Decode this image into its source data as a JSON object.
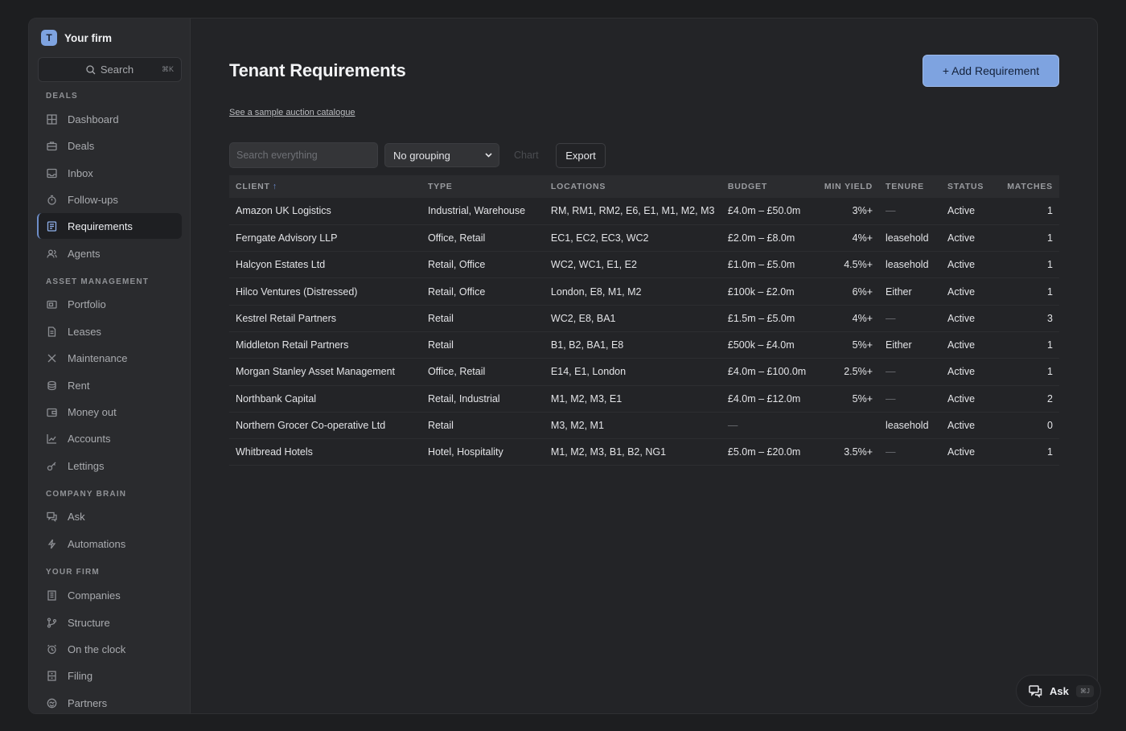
{
  "brand": {
    "logo_letter": "T",
    "name": "Your firm"
  },
  "sidebar": {
    "search_label": "Search",
    "search_shortcut": "⌘K",
    "sections": [
      {
        "label": "DEALS"
      },
      {
        "label": "ASSET MANAGEMENT"
      },
      {
        "label": "COMPANY BRAIN"
      },
      {
        "label": "YOUR FIRM"
      }
    ],
    "items": [
      {
        "label": "Dashboard",
        "icon": "grid-icon"
      },
      {
        "label": "Deals",
        "icon": "briefcase-icon"
      },
      {
        "label": "Inbox",
        "icon": "inbox-icon"
      },
      {
        "label": "Follow-ups",
        "icon": "timer-icon"
      },
      {
        "label": "Requirements",
        "icon": "clipboard-icon",
        "active": true
      },
      {
        "label": "Agents",
        "icon": "users-icon"
      },
      {
        "label": "Portfolio",
        "icon": "portfolio-icon"
      },
      {
        "label": "Leases",
        "icon": "document-icon"
      },
      {
        "label": "Maintenance",
        "icon": "tools-icon"
      },
      {
        "label": "Rent",
        "icon": "coins-icon"
      },
      {
        "label": "Money out",
        "icon": "wallet-icon"
      },
      {
        "label": "Accounts",
        "icon": "chart-line-icon"
      },
      {
        "label": "Lettings",
        "icon": "key-icon"
      },
      {
        "label": "Ask",
        "icon": "chat-icon"
      },
      {
        "label": "Automations",
        "icon": "bolt-icon"
      },
      {
        "label": "Companies",
        "icon": "building-icon"
      },
      {
        "label": "Structure",
        "icon": "branch-icon"
      },
      {
        "label": "On the clock",
        "icon": "alarm-icon"
      },
      {
        "label": "Filing",
        "icon": "cabinet-icon"
      },
      {
        "label": "Partners",
        "icon": "handshake-icon"
      }
    ]
  },
  "main": {
    "title": "Tenant Requirements",
    "add_button": "+ Add Requirement",
    "sample_link": "See a sample auction catalogue",
    "toolbar": {
      "search_placeholder": "Search everything",
      "grouping": "No grouping",
      "chart": "Chart",
      "export": "Export"
    },
    "columns": {
      "client": "CLIENT",
      "sort_indicator": "↑",
      "type": "TYPE",
      "locations": "LOCATIONS",
      "budget": "BUDGET",
      "min_yield": "MIN YIELD",
      "tenure": "TENURE",
      "status": "STATUS",
      "matches": "MATCHES"
    },
    "rows": [
      {
        "client": "Amazon UK Logistics",
        "type": "Industrial, Warehouse",
        "locations": "RM, RM1, RM2, E6, E1, M1, M2, M3",
        "budget": "£4.0m – £50.0m",
        "min_yield": "3%+",
        "tenure": "—",
        "status": "Active",
        "matches": "1"
      },
      {
        "client": "Ferngate Advisory LLP",
        "type": "Office, Retail",
        "locations": "EC1, EC2, EC3, WC2",
        "budget": "£2.0m – £8.0m",
        "min_yield": "4%+",
        "tenure": "leasehold",
        "status": "Active",
        "matches": "1"
      },
      {
        "client": "Halcyon Estates Ltd",
        "type": "Retail, Office",
        "locations": "WC2, WC1, E1, E2",
        "budget": "£1.0m – £5.0m",
        "min_yield": "4.5%+",
        "tenure": "leasehold",
        "status": "Active",
        "matches": "1"
      },
      {
        "client": "Hilco Ventures (Distressed)",
        "type": "Retail, Office",
        "locations": "London, E8, M1, M2",
        "budget": "£100k – £2.0m",
        "min_yield": "6%+",
        "tenure": "Either",
        "status": "Active",
        "matches": "1"
      },
      {
        "client": "Kestrel Retail Partners",
        "type": "Retail",
        "locations": "WC2, E8, BA1",
        "budget": "£1.5m – £5.0m",
        "min_yield": "4%+",
        "tenure": "—",
        "status": "Active",
        "matches": "3"
      },
      {
        "client": "Middleton Retail Partners",
        "type": "Retail",
        "locations": "B1, B2, BA1, E8",
        "budget": "£500k – £4.0m",
        "min_yield": "5%+",
        "tenure": "Either",
        "status": "Active",
        "matches": "1"
      },
      {
        "client": "Morgan Stanley Asset Management",
        "type": "Office, Retail",
        "locations": "E14, E1, London",
        "budget": "£4.0m – £100.0m",
        "min_yield": "2.5%+",
        "tenure": "—",
        "status": "Active",
        "matches": "1"
      },
      {
        "client": "Northbank Capital",
        "type": "Retail, Industrial",
        "locations": "M1, M2, M3, E1",
        "budget": "£4.0m – £12.0m",
        "min_yield": "5%+",
        "tenure": "—",
        "status": "Active",
        "matches": "2"
      },
      {
        "client": "Northern Grocer Co-operative Ltd",
        "type": "Retail",
        "locations": "M3, M2, M1",
        "budget": "—",
        "min_yield": "",
        "tenure": "leasehold",
        "status": "Active",
        "matches": "0"
      },
      {
        "client": "Whitbread Hotels",
        "type": "Hotel, Hospitality",
        "locations": "M1, M2, M3, B1, B2, NG1",
        "budget": "£5.0m – £20.0m",
        "min_yield": "3.5%+",
        "tenure": "—",
        "status": "Active",
        "matches": "1"
      }
    ]
  },
  "ask_fab": {
    "label": "Ask",
    "shortcut": "⌘J"
  },
  "colors": {
    "accent": "#7ea3e0",
    "background": "#232427",
    "sidebar": "#2a2b2e"
  }
}
